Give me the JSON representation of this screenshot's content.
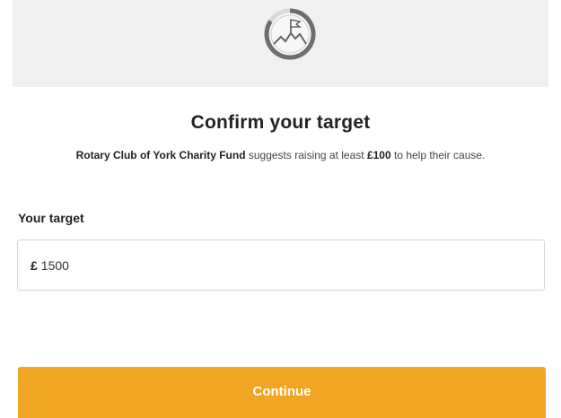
{
  "hero": {
    "icon": "flag-on-mountain-icon"
  },
  "title": "Confirm your target",
  "subtitle": {
    "charity_name": "Rotary Club of York Charity Fund",
    "middle_text": " suggests raising at least ",
    "amount": "£100",
    "end_text": " to help their cause."
  },
  "target_field": {
    "label": "Your target",
    "currency_symbol": "£",
    "value": "1500"
  },
  "continue_button": {
    "label": "Continue"
  },
  "colors": {
    "accent": "#f0a623",
    "hero_background": "#f0f0f0"
  }
}
